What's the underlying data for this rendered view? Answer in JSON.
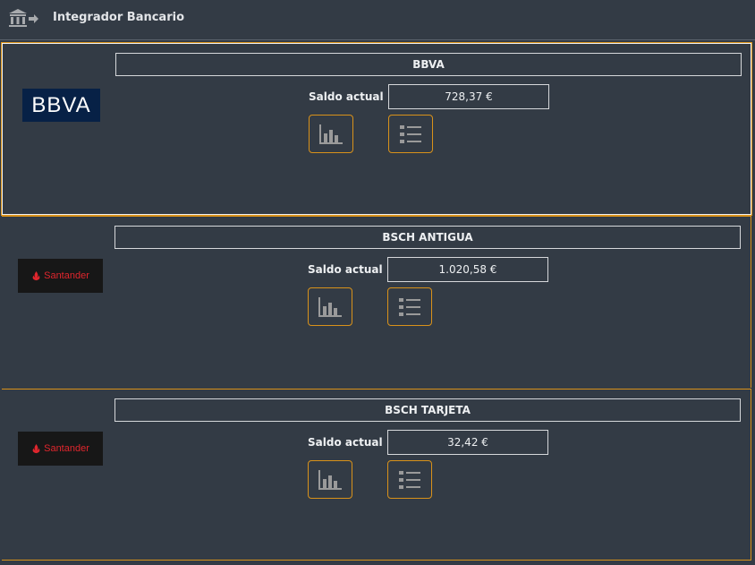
{
  "app": {
    "title": "Integrador Bancario",
    "icon": "bank-transfer-icon"
  },
  "accounts": [
    {
      "name": "BBVA",
      "logo_text": "BBVA",
      "logo_colors": {
        "background": "#072146",
        "text": "#ffffff"
      },
      "balance_label": "Saldo actual",
      "balance": "728,37 €",
      "selected": true,
      "actions": [
        {
          "icon": "bar-chart-icon"
        },
        {
          "icon": "list-icon"
        }
      ]
    },
    {
      "name": "BSCH ANTIGUA",
      "logo_text": "Santander",
      "logo_colors": {
        "background": "#171717",
        "text": "#e0262d"
      },
      "balance_label": "Saldo actual",
      "balance": "1.020,58 €",
      "selected": false,
      "actions": [
        {
          "icon": "bar-chart-icon"
        },
        {
          "icon": "list-icon"
        }
      ]
    },
    {
      "name": "BSCH TARJETA",
      "logo_text": "Santander",
      "logo_colors": {
        "background": "#171717",
        "text": "#e0262d"
      },
      "balance_label": "Saldo actual",
      "balance": "32,42 €",
      "selected": false,
      "actions": [
        {
          "icon": "bar-chart-icon"
        },
        {
          "icon": "list-icon"
        }
      ]
    }
  ],
  "colors": {
    "background": "#333b45",
    "accent_border": "#d9921a",
    "box_border": "#d6d8db",
    "icon_gray": "#9a9a9a"
  }
}
